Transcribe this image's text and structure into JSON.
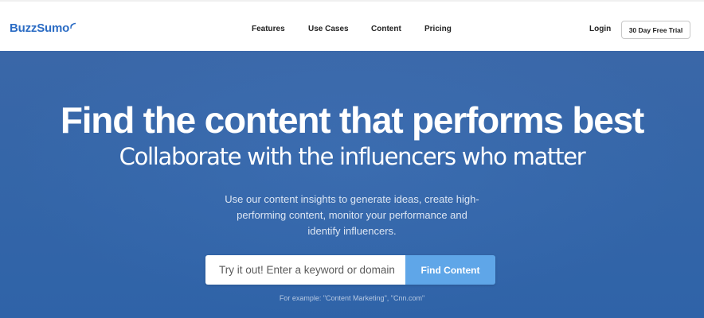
{
  "brand": {
    "name": "BuzzSumo",
    "color": "#2b6cc4"
  },
  "nav": {
    "items": [
      {
        "label": "Features"
      },
      {
        "label": "Use Cases"
      },
      {
        "label": "Content"
      },
      {
        "label": "Pricing"
      }
    ],
    "login_label": "Login",
    "trial_label": "30 Day Free Trial"
  },
  "hero": {
    "title": "Find the content that performs best",
    "subtitle": "Collaborate with the influencers who matter",
    "description": "Use our content insights to generate ideas, create high-performing content, monitor your performance and identify influencers.",
    "background_color": "#3566a8",
    "search": {
      "placeholder": "Try it out! Enter a keyword or domain",
      "value": "",
      "button_label": "Find Content",
      "button_color": "#5fa6e8"
    },
    "example_text": "For example: \"Content Marketing\", \"Cnn.com\""
  }
}
